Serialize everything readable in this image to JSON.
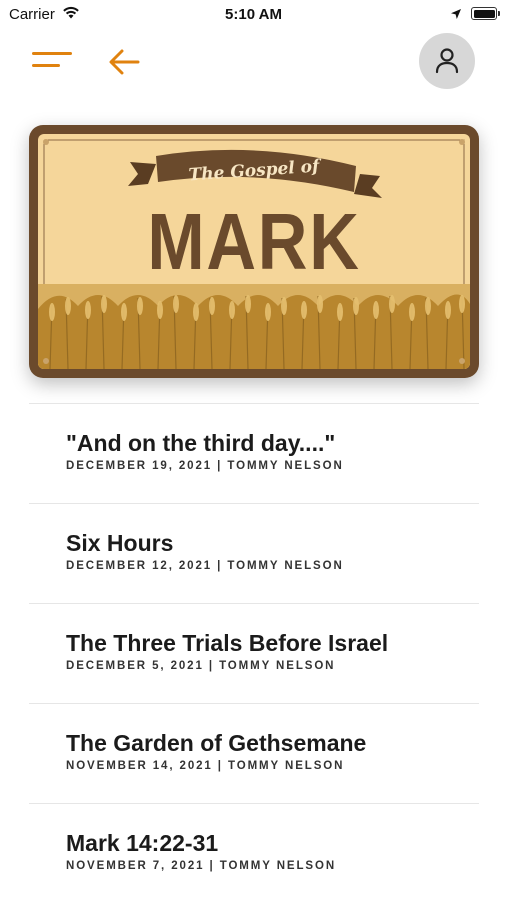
{
  "status_bar": {
    "carrier": "Carrier",
    "time": "5:10 AM",
    "icons": [
      "wifi-icon",
      "location-arrow-icon",
      "battery-icon"
    ]
  },
  "nav": {
    "menu_icon": "hamburger-menu-icon",
    "back_icon": "back-arrow-icon",
    "profile_icon": "user-icon",
    "accent_color": "#e0820f"
  },
  "banner": {
    "subtitle": "The Gospel of",
    "title": "MARK",
    "colors": {
      "frame": "#6b4a2c",
      "background": "#f5d69a",
      "wheat": "#c89a3c"
    }
  },
  "sermons": [
    {
      "title": "\"And on the third day....\"",
      "meta": "DECEMBER 19, 2021 | TOMMY NELSON"
    },
    {
      "title": "Six Hours",
      "meta": "DECEMBER 12, 2021 | TOMMY NELSON"
    },
    {
      "title": "The Three Trials Before Israel",
      "meta": "DECEMBER 5, 2021 | TOMMY NELSON"
    },
    {
      "title": "The Garden of Gethsemane",
      "meta": "NOVEMBER 14, 2021 | TOMMY NELSON"
    },
    {
      "title": "Mark 14:22-31",
      "meta": "NOVEMBER 7, 2021 | TOMMY NELSON"
    }
  ]
}
